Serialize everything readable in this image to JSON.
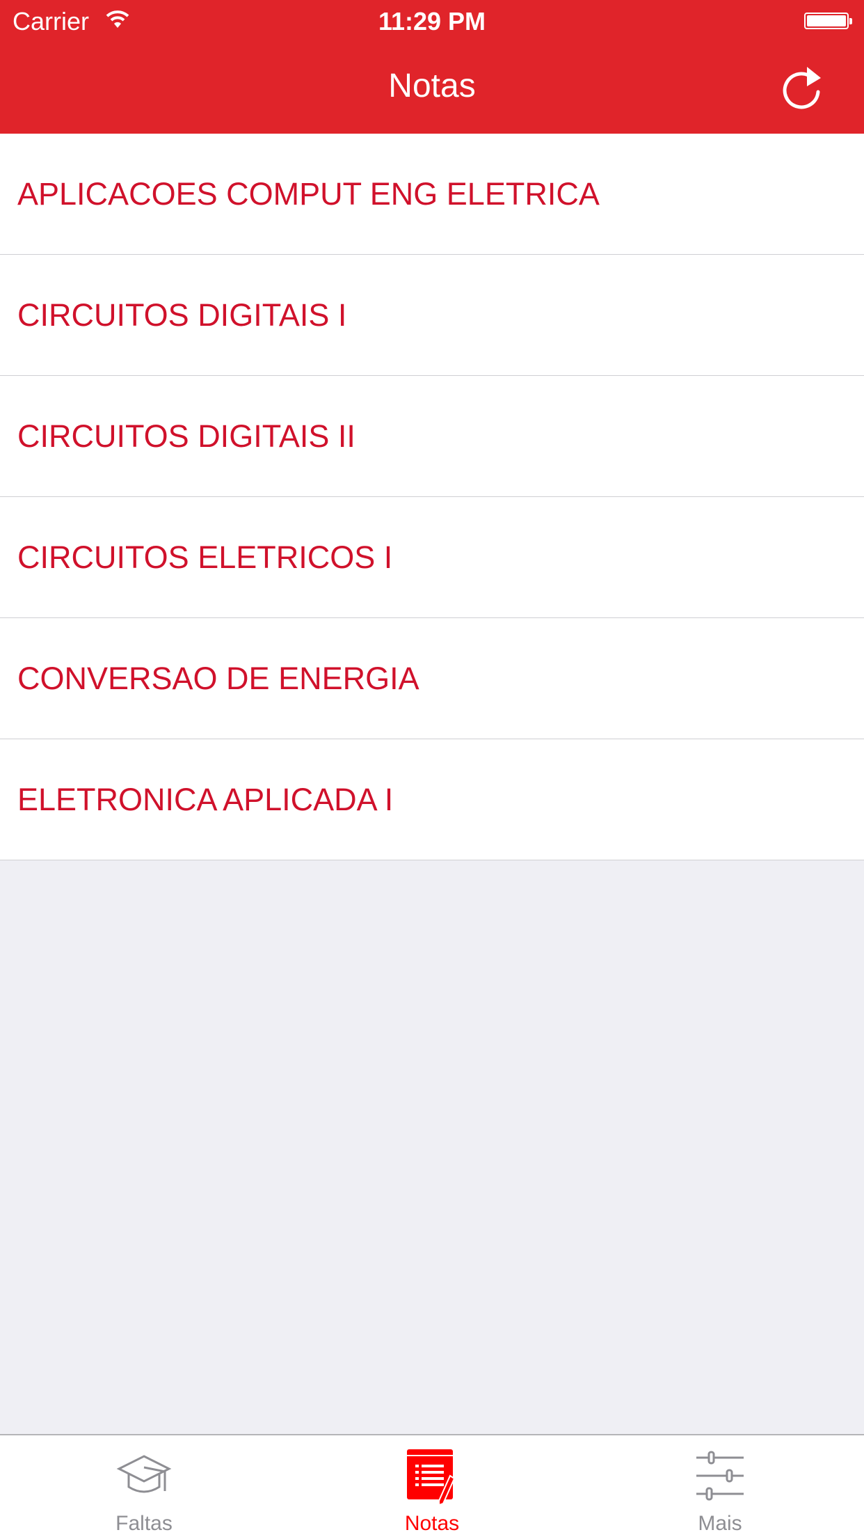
{
  "status_bar": {
    "carrier": "Carrier",
    "time": "11:29 PM"
  },
  "header": {
    "title": "Notas"
  },
  "courses": [
    {
      "label": "APLICACOES COMPUT ENG ELETRICA"
    },
    {
      "label": "CIRCUITOS DIGITAIS I"
    },
    {
      "label": "CIRCUITOS DIGITAIS II"
    },
    {
      "label": "CIRCUITOS ELETRICOS I"
    },
    {
      "label": "CONVERSAO DE ENERGIA"
    },
    {
      "label": "ELETRONICA APLICADA I"
    }
  ],
  "tabs": [
    {
      "label": "Faltas",
      "icon": "graduation-cap-icon",
      "active": false
    },
    {
      "label": "Notas",
      "icon": "notes-pencil-icon",
      "active": true
    },
    {
      "label": "Mais",
      "icon": "sliders-icon",
      "active": false
    }
  ],
  "colors": {
    "brand": "#e0242a",
    "item_text": "#d0112b",
    "tab_active": "#ff0000",
    "tab_inactive": "#8e8e93"
  }
}
